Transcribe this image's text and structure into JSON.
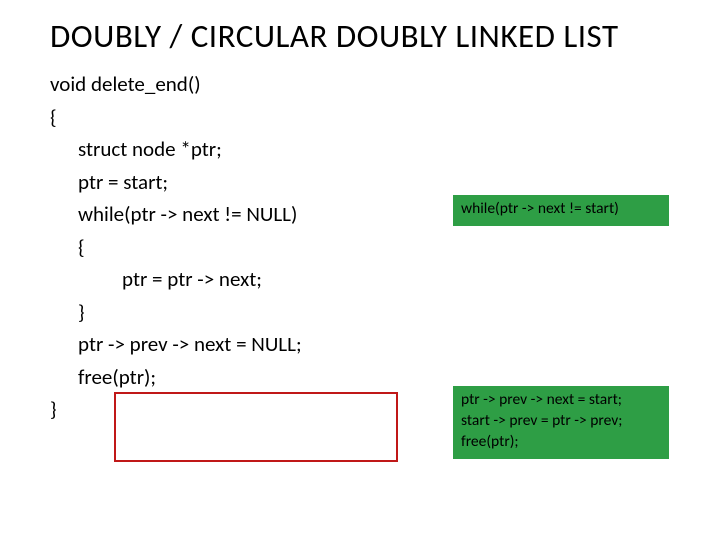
{
  "title": "DOUBLY / CIRCULAR DOUBLY LINKED LIST",
  "code": {
    "l1": "void delete_end()",
    "l2": "{",
    "l3": "struct node *ptr;",
    "l4": "ptr = start;",
    "l5": "while(ptr -> next != NULL)",
    "l6": "{",
    "l7": "ptr = ptr -> next;",
    "l8": "}",
    "l9": "ptr -> prev -> next = NULL;",
    "l10": "free(ptr);",
    "l11": "}"
  },
  "box1": {
    "line1": "while(ptr -> next != start)"
  },
  "box2": {
    "line1": "ptr -> prev -> next = start;",
    "line2": "start -> prev = ptr -> prev;",
    "line3": "free(ptr);"
  }
}
